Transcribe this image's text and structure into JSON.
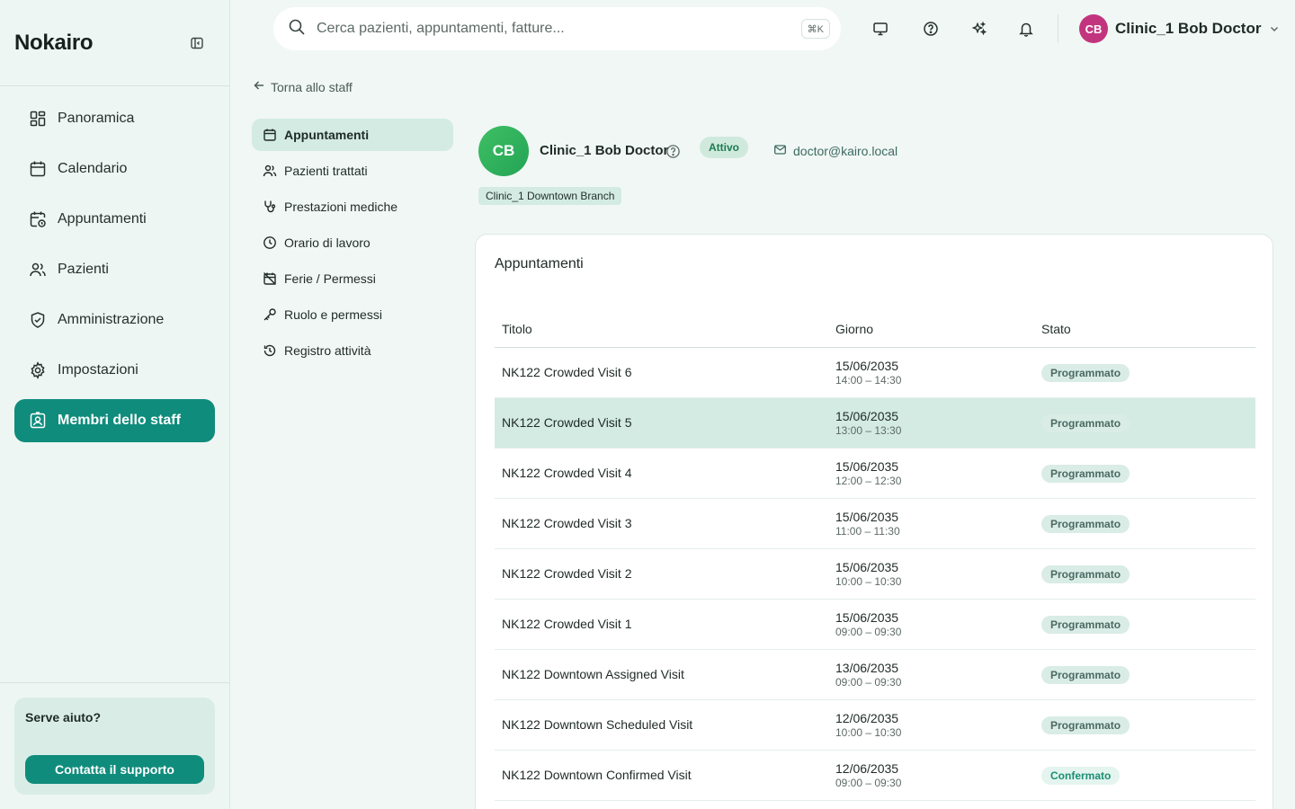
{
  "app": {
    "brand": "Nokairo"
  },
  "sidebar": {
    "items": [
      {
        "label": "Panoramica",
        "icon": "dashboard-icon"
      },
      {
        "label": "Calendario",
        "icon": "calendar-icon"
      },
      {
        "label": "Appuntamenti",
        "icon": "calendar-clock-icon"
      },
      {
        "label": "Pazienti",
        "icon": "users-icon"
      },
      {
        "label": "Amministrazione",
        "icon": "shield-icon"
      },
      {
        "label": "Impostazioni",
        "icon": "gear-icon"
      },
      {
        "label": "Membri dello staff",
        "icon": "id-badge-icon",
        "active": true
      }
    ],
    "help": {
      "title": "Serve aiuto?",
      "button": "Contatta il supporto"
    }
  },
  "header": {
    "search_placeholder": "Cerca pazienti, appuntamenti, fatture...",
    "shortcut": "⌘K",
    "user": {
      "initials": "CB",
      "name": "Clinic_1 Bob Doctor"
    }
  },
  "page": {
    "back_label": "Torna allo staff",
    "subnav": [
      {
        "label": "Appuntamenti",
        "icon": "calendar-icon",
        "active": true
      },
      {
        "label": "Pazienti trattati",
        "icon": "users-icon"
      },
      {
        "label": "Prestazioni mediche",
        "icon": "stethoscope-icon"
      },
      {
        "label": "Orario di lavoro",
        "icon": "clock-icon"
      },
      {
        "label": "Ferie / Permessi",
        "icon": "calendar-off-icon"
      },
      {
        "label": "Ruolo e permessi",
        "icon": "key-icon"
      },
      {
        "label": "Registro attività",
        "icon": "history-icon"
      }
    ],
    "profile": {
      "initials": "CB",
      "name": "Clinic_1 Bob Doctor",
      "status": "Attivo",
      "email": "doctor@kairo.local",
      "branch": "Clinic_1 Downtown Branch"
    },
    "appointments": {
      "title": "Appuntamenti",
      "columns": {
        "title": "Titolo",
        "day": "Giorno",
        "status": "Stato"
      },
      "rows": [
        {
          "title": "NK122 Crowded Visit 6",
          "date": "15/06/2035",
          "time": "14:00 – 14:30",
          "status": "Programmato"
        },
        {
          "title": "NK122 Crowded Visit 5",
          "date": "15/06/2035",
          "time": "13:00 – 13:30",
          "status": "Programmato"
        },
        {
          "title": "NK122 Crowded Visit 4",
          "date": "15/06/2035",
          "time": "12:00 – 12:30",
          "status": "Programmato"
        },
        {
          "title": "NK122 Crowded Visit 3",
          "date": "15/06/2035",
          "time": "11:00 – 11:30",
          "status": "Programmato"
        },
        {
          "title": "NK122 Crowded Visit 2",
          "date": "15/06/2035",
          "time": "10:00 – 10:30",
          "status": "Programmato"
        },
        {
          "title": "NK122 Crowded Visit 1",
          "date": "15/06/2035",
          "time": "09:00 – 09:30",
          "status": "Programmato"
        },
        {
          "title": "NK122 Downtown Assigned Visit",
          "date": "13/06/2035",
          "time": "09:00 – 09:30",
          "status": "Programmato"
        },
        {
          "title": "NK122 Downtown Scheduled Visit",
          "date": "12/06/2035",
          "time": "10:00 – 10:30",
          "status": "Programmato"
        },
        {
          "title": "NK122 Downtown Confirmed Visit",
          "date": "12/06/2035",
          "time": "09:00 – 09:30",
          "status": "Confermato"
        }
      ]
    }
  },
  "colors": {
    "accent": "#0f8c7c",
    "avatar_user": "#c2357e",
    "avatar_profile": "#2fb35c"
  }
}
